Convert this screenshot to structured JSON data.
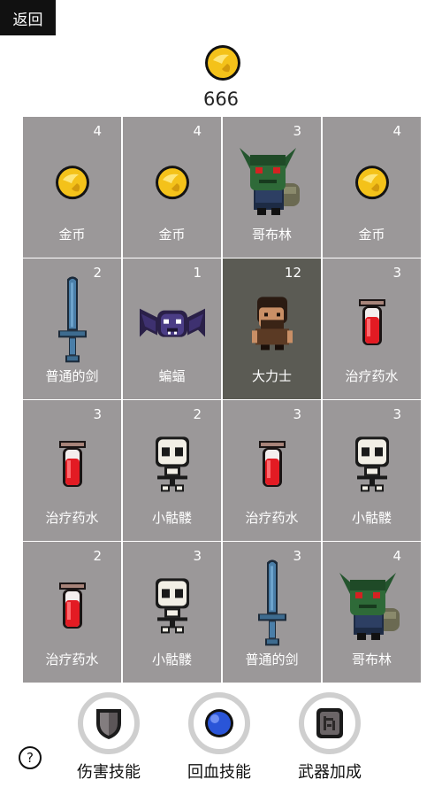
{
  "header": {
    "back_label": "返回"
  },
  "gold": {
    "icon": "coin-icon",
    "amount": "666"
  },
  "grid": [
    {
      "name": "金币",
      "count": "4",
      "icon": "coin"
    },
    {
      "name": "金币",
      "count": "4",
      "icon": "coin"
    },
    {
      "name": "哥布林",
      "count": "3",
      "icon": "goblin"
    },
    {
      "name": "金币",
      "count": "4",
      "icon": "coin"
    },
    {
      "name": "普通的剑",
      "count": "2",
      "icon": "sword"
    },
    {
      "name": "蝙蝠",
      "count": "1",
      "icon": "bat"
    },
    {
      "name": "大力士",
      "count": "12",
      "icon": "strongman",
      "selected": true
    },
    {
      "name": "治疗药水",
      "count": "3",
      "icon": "potion"
    },
    {
      "name": "治疗药水",
      "count": "3",
      "icon": "potion"
    },
    {
      "name": "小骷髅",
      "count": "2",
      "icon": "skull"
    },
    {
      "name": "治疗药水",
      "count": "3",
      "icon": "potion"
    },
    {
      "name": "小骷髅",
      "count": "3",
      "icon": "skull"
    },
    {
      "name": "治疗药水",
      "count": "2",
      "icon": "potion"
    },
    {
      "name": "小骷髅",
      "count": "3",
      "icon": "skull"
    },
    {
      "name": "普通的剑",
      "count": "3",
      "icon": "sword"
    },
    {
      "name": "哥布林",
      "count": "4",
      "icon": "goblin"
    }
  ],
  "skills": [
    {
      "label": "伤害技能",
      "icon": "shield-icon"
    },
    {
      "label": "回血技能",
      "icon": "blue-orb-icon"
    },
    {
      "label": "武器加成",
      "icon": "rune-stone-icon"
    }
  ],
  "help": {
    "label": "?"
  },
  "colors": {
    "cell": "#9b9899",
    "selected_cell": "#5b5b54"
  }
}
